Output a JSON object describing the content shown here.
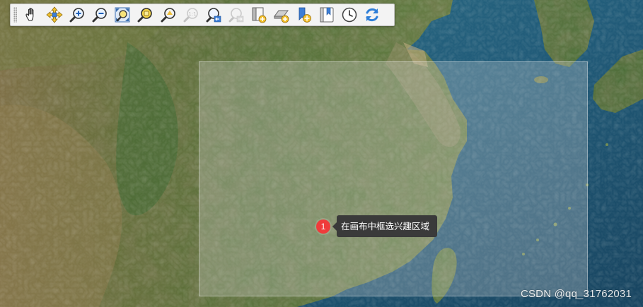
{
  "toolbar": {
    "tools": [
      {
        "icon": "pan-hand-icon"
      },
      {
        "icon": "pan-to-selection-icon"
      },
      {
        "icon": "zoom-in-icon"
      },
      {
        "icon": "zoom-out-icon"
      },
      {
        "icon": "zoom-full-icon"
      },
      {
        "icon": "zoom-to-selection-icon"
      },
      {
        "icon": "zoom-to-layer-icon"
      },
      {
        "icon": "zoom-native-resolution-icon"
      },
      {
        "icon": "zoom-last-icon"
      },
      {
        "icon": "zoom-next-icon"
      },
      {
        "icon": "new-map-view-icon"
      },
      {
        "icon": "new-3d-map-view-icon"
      },
      {
        "icon": "new-bookmark-icon"
      },
      {
        "icon": "show-bookmarks-icon"
      },
      {
        "icon": "temporal-controller-icon"
      },
      {
        "icon": "refresh-icon"
      }
    ]
  },
  "annotation": {
    "step_number": "1",
    "text": "在画布中框选兴趣区域"
  },
  "watermark": "CSDN @qq_31762031",
  "colors": {
    "ocean": "#1f5a78",
    "land": "#5d7a3c",
    "selection_fill": "rgba(220,220,220,0.28)",
    "badge": "#ef3b3b",
    "tooltip_bg": "#3a3a3a"
  }
}
